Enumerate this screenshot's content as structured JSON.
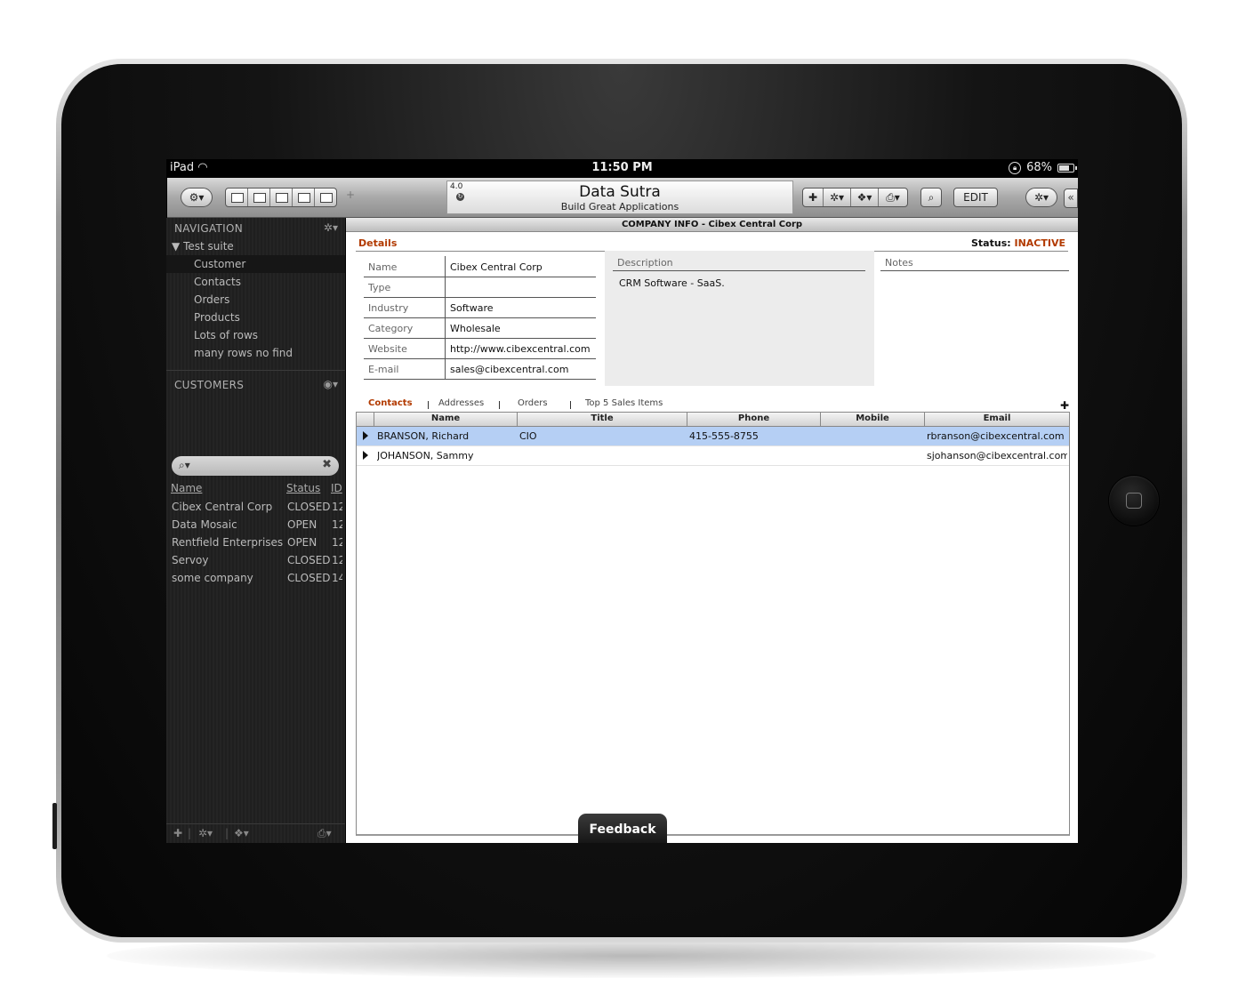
{
  "statusbar": {
    "device": "iPad",
    "time": "11:50 PM",
    "battery": "68%"
  },
  "toolbar": {
    "version": "4.0",
    "app_title": "Data Sutra",
    "app_subtitle": "Build Great Applications",
    "edit_label": "EDIT",
    "add_glyph": "✚",
    "action_glyph": "✲",
    "collapse_glyph": "«"
  },
  "navigation": {
    "header": "NAVIGATION",
    "group": "Test suite",
    "items": [
      "Customer",
      "Contacts",
      "Orders",
      "Products",
      "Lots of rows",
      "many rows no find"
    ],
    "selected": "Customer"
  },
  "customers": {
    "header": "CUSTOMERS",
    "search_placeholder": "",
    "columns": [
      "Name",
      "Status",
      "ID"
    ],
    "rows": [
      {
        "name": "Cibex Central Corp",
        "status": "CLOSED",
        "id": "12"
      },
      {
        "name": "Data Mosaic",
        "status": "OPEN",
        "id": "12"
      },
      {
        "name": "Rentfield Enterprises",
        "status": "OPEN",
        "id": "12"
      },
      {
        "name": "Servoy",
        "status": "CLOSED",
        "id": "12"
      },
      {
        "name": "some company",
        "status": "CLOSED",
        "id": "14"
      }
    ]
  },
  "company": {
    "title": "COMPANY INFO - Cibex Central Corp",
    "details_label": "Details",
    "status_label": "Status:",
    "status_value": "INACTIVE",
    "fields": [
      {
        "label": "Name",
        "value": "Cibex Central Corp"
      },
      {
        "label": "Type",
        "value": ""
      },
      {
        "label": "Industry",
        "value": "Software"
      },
      {
        "label": "Category",
        "value": "Wholesale"
      },
      {
        "label": "Website",
        "value": "http://www.cibexcentral.com"
      },
      {
        "label": "E-mail",
        "value": "sales@cibexcentral.com"
      }
    ],
    "description_label": "Description",
    "description": "CRM Software - SaaS.",
    "notes_label": "Notes"
  },
  "tabs": [
    "Contacts",
    "Addresses",
    "Orders",
    "Top 5 Sales Items"
  ],
  "active_tab": "Contacts",
  "contacts": {
    "columns": [
      "Name",
      "Title",
      "Phone",
      "Mobile",
      "Email"
    ],
    "rows": [
      {
        "name": "BRANSON, Richard",
        "title": "CIO",
        "phone": "415-555-8755",
        "mobile": "",
        "email": "rbranson@cibexcentral.com"
      },
      {
        "name": "JOHANSON, Sammy",
        "title": "",
        "phone": "",
        "mobile": "",
        "email": "sjohanson@cibexcentral.com"
      }
    ]
  },
  "feedback_label": "Feedback",
  "colors": {
    "accent": "#b23a00",
    "selection": "#b5cff4",
    "sidebar": "#222222"
  }
}
